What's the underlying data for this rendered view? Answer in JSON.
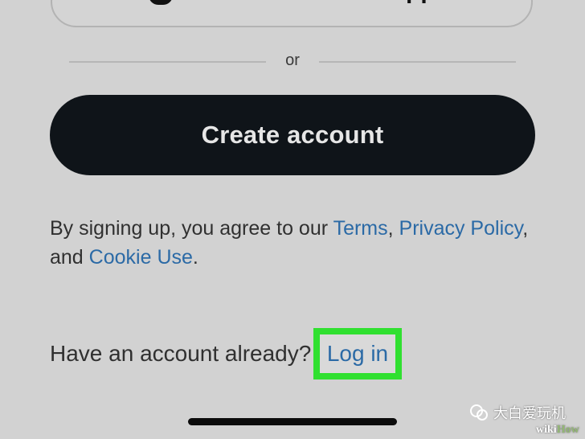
{
  "apple_button": {
    "label": "pp",
    "icon": "apple-icon"
  },
  "divider": {
    "text": "or"
  },
  "create_account": {
    "label": "Create account"
  },
  "terms": {
    "prefix": "By signing up, you agree to our ",
    "terms_link": "Terms",
    "sep1": ", ",
    "privacy_link": "Privacy Policy",
    "sep2": ",",
    "and": "and ",
    "cookie_link": "Cookie Use",
    "suffix": "."
  },
  "login_prompt": {
    "text": "Have an account already?",
    "link": "Log in"
  },
  "watermark": {
    "text": "大白爱玩机",
    "wiki": "wiki",
    "how": "How"
  },
  "colors": {
    "background": "#d2d2d2",
    "button": "#0f1419",
    "link": "#2b6aa6",
    "highlight": "#30e030"
  }
}
